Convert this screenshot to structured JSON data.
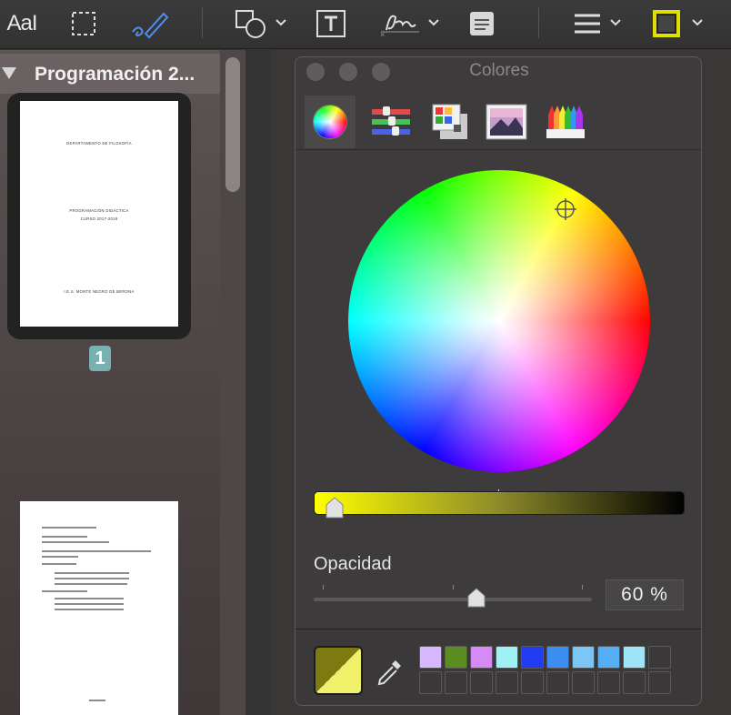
{
  "toolbar": {
    "text_tool_label": "AaI",
    "icons": [
      "text-tool-icon",
      "rect-select-icon",
      "sketch-icon",
      "shapes-icon",
      "text-box-icon",
      "signature-icon",
      "note-icon",
      "line-style-icon",
      "border-color-icon"
    ]
  },
  "sidebar": {
    "doc_title": "Programación 2...",
    "page_number": "1",
    "page1_text": {
      "line1": "DEPARTAMENTO DE FILOSOFÍA",
      "line2": "PROGRAMACIÓN DIDÁCTICA",
      "line3": "CURSO 2017-2018",
      "line4": "I.E.S. MONTE NEGRO DE BERONA"
    }
  },
  "panel": {
    "title": "Colores",
    "modes": [
      "color-wheel",
      "color-sliders",
      "color-palettes",
      "image-palettes",
      "pencils"
    ],
    "opacity_label": "Opacidad",
    "opacity_value": "60 %",
    "opacity_level": 0.6,
    "current_color": "#7c7a10",
    "swatches": [
      "#d6b8ff",
      "#5b8c22",
      "#d58af5",
      "#9ef2f5",
      "#1f3cf0",
      "#3b8ef0",
      "#7cc6f5",
      "#56aef5",
      "#9ee6f7",
      "",
      "",
      "",
      "",
      "",
      "",
      "",
      "",
      "",
      "",
      ""
    ]
  }
}
